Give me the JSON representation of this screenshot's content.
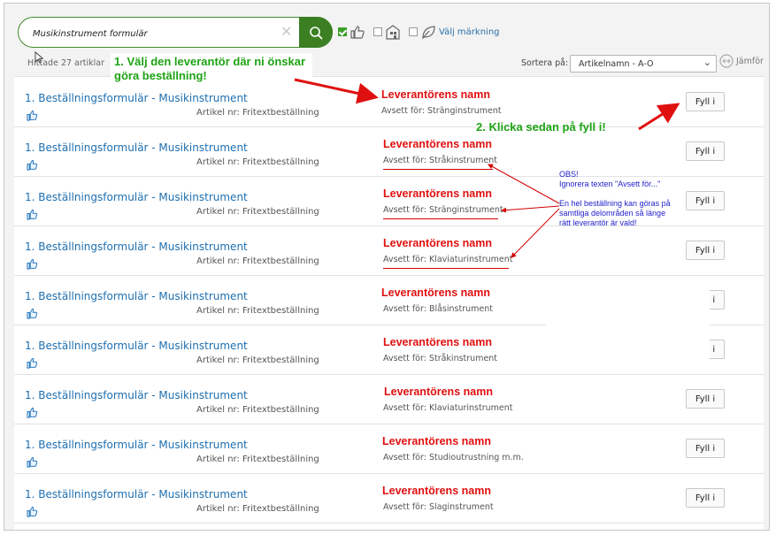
{
  "search": {
    "value": "Musikinstrument formulär"
  },
  "filters": {
    "label": "Välj märkning"
  },
  "results": {
    "count_text": "Hittade 27 artiklar"
  },
  "sort": {
    "label": "Sortera på:",
    "value": "Artikelnamn - A-O"
  },
  "compare": {
    "label": "Jämför"
  },
  "rows": [
    {
      "title": "1. Beställningsformulär - Musikinstrument",
      "article": "Artikel nr: Fritextbeställning",
      "vendor": "Leverantörens namn",
      "for": "Avsett för: Stränginstrument",
      "button": "Fyll i"
    },
    {
      "title": "1. Beställningsformulär - Musikinstrument",
      "article": "Artikel nr: Fritextbeställning",
      "vendor": "Leverantörens namn",
      "for": "Avsett för: Stråkinstrument",
      "button": "Fyll i"
    },
    {
      "title": "1. Beställningsformulär - Musikinstrument",
      "article": "Artikel nr: Fritextbeställning",
      "vendor": "Leverantörens namn",
      "for": "Avsett för: Stränginstrument",
      "button": "Fyll i"
    },
    {
      "title": "1. Beställningsformulär - Musikinstrument",
      "article": "Artikel nr: Fritextbeställning",
      "vendor": "Leverantörens namn",
      "for": "Avsett för: Klaviaturinstrument",
      "button": "Fyll i"
    },
    {
      "title": "1. Beställningsformulär - Musikinstrument",
      "article": "Artikel nr: Fritextbeställning",
      "vendor": "Leverantörens namn",
      "for": "Avsett för: Blåsinstrument",
      "button": "Fyll i"
    },
    {
      "title": "1. Beställningsformulär - Musikinstrument",
      "article": "Artikel nr: Fritextbeställning",
      "vendor": "Leverantörens namn",
      "for": "Avsett för: Stråkinstrument",
      "button": "Fyll i"
    },
    {
      "title": "1. Beställningsformulär - Musikinstrument",
      "article": "Artikel nr: Fritextbeställning",
      "vendor": "Leverantörens namn",
      "for": "Avsett för: Klaviaturinstrument",
      "button": "Fyll i"
    },
    {
      "title": "1. Beställningsformulär - Musikinstrument",
      "article": "Artikel nr: Fritextbeställning",
      "vendor": "Leverantörens namn",
      "for": "Avsett för: Studioutrustning m.m.",
      "button": "Fyll i"
    },
    {
      "title": "1. Beställningsformulär - Musikinstrument",
      "article": "Artikel nr: Fritextbeställning",
      "vendor": "Leverantörens namn",
      "for": "Avsett för: Slaginstrument",
      "button": "Fyll i"
    }
  ],
  "annotations": {
    "step1": "1. Välj den leverantör där ni önskar göra beställning!",
    "step2": "2. Klicka sedan på fyll i!",
    "obs_title": "OBS!",
    "obs_line1": "Ignorera texten \"Avsett för...\"",
    "obs_line2": "En hel beställning kan göras på samtliga delområden så länge rätt leverantör är vald!"
  },
  "colors": {
    "brand_green": "#3b7f22",
    "link_blue": "#1e6fb0",
    "vendor_red": "#e01010",
    "note_green": "#1ea314",
    "note_blue": "#2222cc"
  }
}
